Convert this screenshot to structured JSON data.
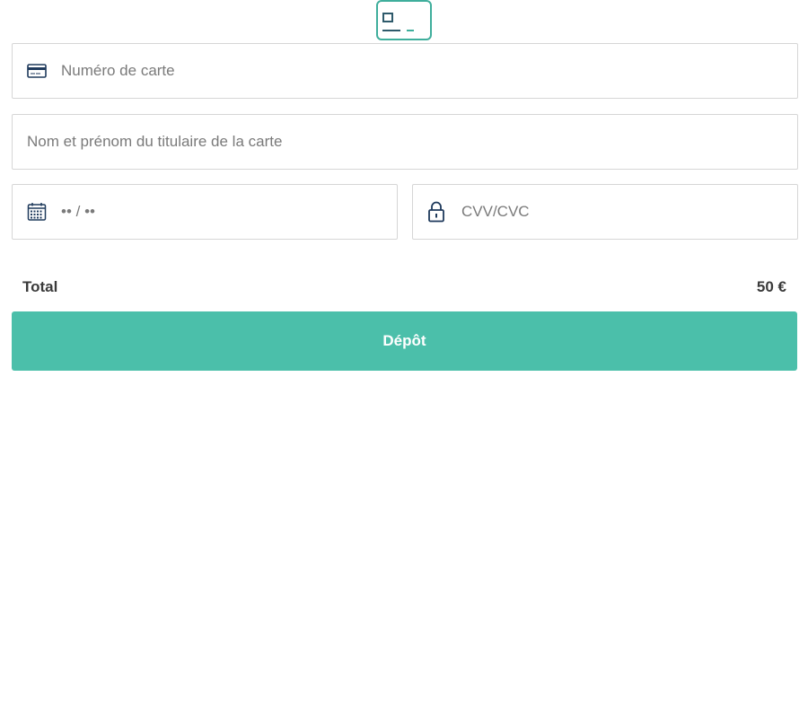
{
  "form": {
    "card_number": {
      "placeholder": "Numéro de carte",
      "value": ""
    },
    "card_holder": {
      "placeholder": "Nom et prénom du titulaire de la carte",
      "value": ""
    },
    "expiry": {
      "placeholder": "•• / ••",
      "value": ""
    },
    "cvv": {
      "placeholder": "CVV/CVC",
      "value": ""
    }
  },
  "summary": {
    "total_label": "Total",
    "total_value": "50 €"
  },
  "actions": {
    "submit_label": "Dépôt"
  },
  "icons": {
    "header": "card-icon",
    "card_number": "credit-card-icon",
    "expiry": "calendar-icon",
    "cvv": "lock-icon"
  },
  "colors": {
    "accent": "#4bbfaa",
    "icon_dark": "#1f3a5c",
    "border": "#d6d6d6",
    "placeholder": "#7a7a7a"
  }
}
